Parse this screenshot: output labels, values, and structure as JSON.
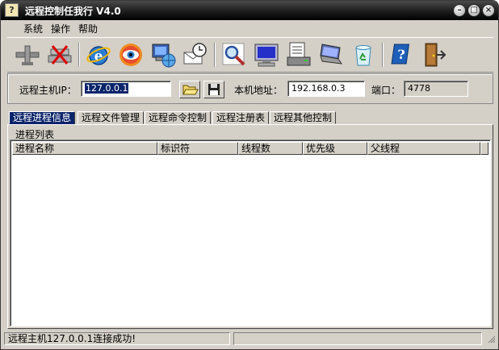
{
  "window": {
    "title": "远程控制任我行 V4.0",
    "app_icon_glyph": "?",
    "minimize_glyph": "–",
    "maximize_glyph": "□",
    "close_glyph": "×"
  },
  "menu": {
    "items": [
      "系统",
      "操作",
      "帮助"
    ]
  },
  "toolbar": {
    "icons": [
      "connect-icon",
      "disconnect-icon",
      "internet-explorer-icon",
      "eye-monitor-icon",
      "network-computer-icon",
      "mail-clock-icon",
      "magnifier-icon",
      "monitor-icon",
      "printer-icon",
      "laptop-icon",
      "recycle-bin-icon",
      "help-book-icon",
      "exit-door-icon"
    ]
  },
  "address": {
    "remote_host_label": "远程主机IP：",
    "remote_host_value": "127.0.0.1",
    "local_addr_label": "本机地址：",
    "local_addr_value": "192.168.0.3",
    "port_label": "端口：",
    "port_value": "4778"
  },
  "tabs": [
    "远程进程信息",
    "远程文件管理",
    "远程命令控制",
    "远程注册表",
    "远程其他控制"
  ],
  "active_tab": 0,
  "process_list": {
    "group_label": "进程列表",
    "columns": [
      "进程名称",
      "标识符",
      "线程数",
      "优先级",
      "父线程"
    ],
    "rows": []
  },
  "status": {
    "message": "远程主机127.0.0.1连接成功!",
    "second_panel": ""
  },
  "colors": {
    "titlebar": "#1c1c1c",
    "selection": "#0a246a",
    "face": "#d4d0c8"
  }
}
